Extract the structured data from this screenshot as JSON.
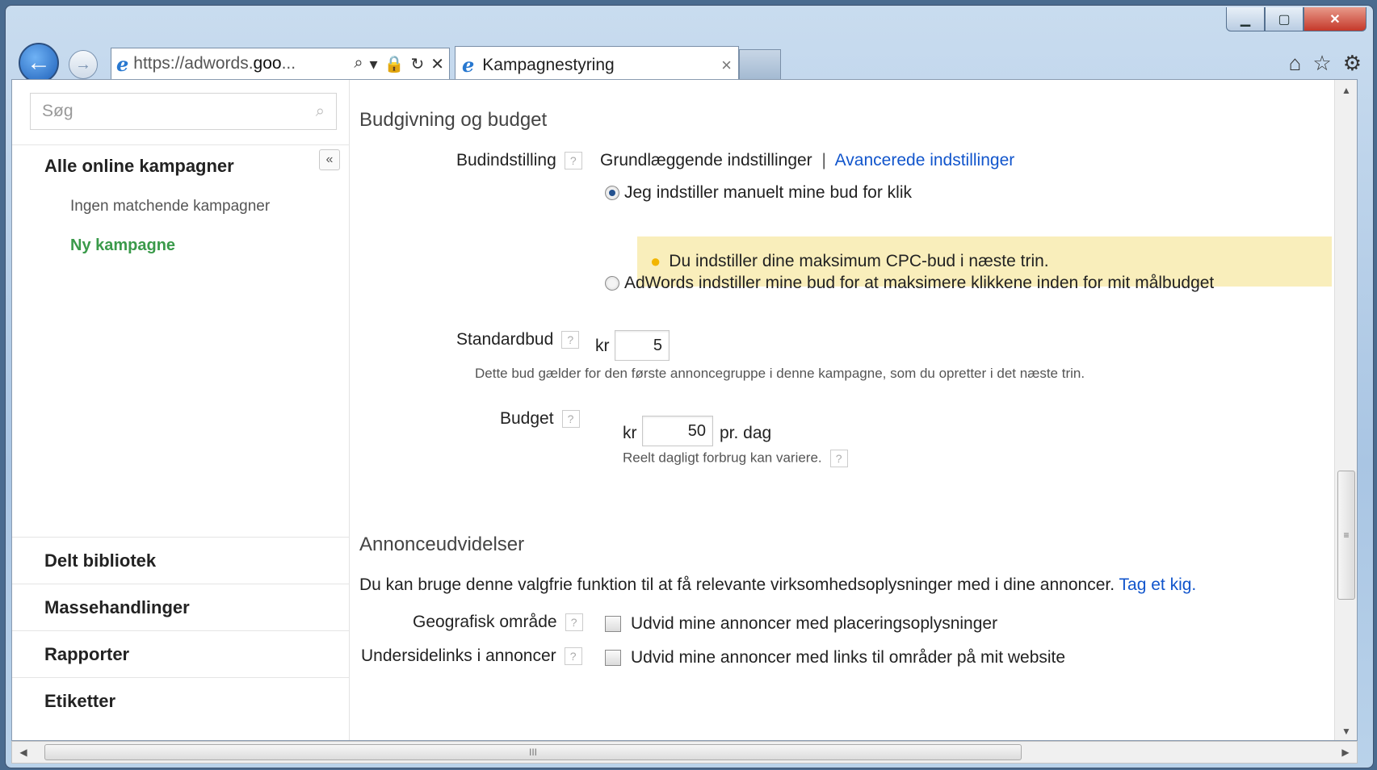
{
  "window": {
    "minimize_glyph": "▁",
    "maximize_glyph": "▢",
    "close_glyph": "✕"
  },
  "nav": {
    "back_glyph": "←",
    "forward_glyph": "→",
    "url_prefix": "https://adwords.",
    "url_bold": "goo",
    "url_suffix": "...",
    "search_glyph": "⌕",
    "dropdown_glyph": "▾",
    "lock_glyph": "🔒",
    "refresh_glyph": "↻",
    "stop_glyph": "✕"
  },
  "tab": {
    "title": "Kampagnestyring",
    "close_glyph": "×"
  },
  "toolbar": {
    "home_glyph": "⌂",
    "favorites_glyph": "☆",
    "tools_glyph": "⚙"
  },
  "sidebar": {
    "search_placeholder": "Søg",
    "collapse_glyph": "«",
    "all_campaigns": "Alle online kampagner",
    "no_matching": "Ingen matchende kampagner",
    "new_campaign": "Ny kampagne",
    "bottom_items": [
      "Delt bibliotek",
      "Massehandlinger",
      "Rapporter",
      "Etiketter"
    ]
  },
  "bidding": {
    "section_title": "Budgivning og budget",
    "bid_setting_label": "Budindstilling",
    "basic_settings": "Grundlæggende indstillinger",
    "separator": "|",
    "advanced_settings": "Avancerede indstillinger",
    "manual_option": "Jeg indstiller manuelt mine bud for klik",
    "note": "Du indstiller dine maksimum CPC-bud i næste trin.",
    "auto_option": "AdWords indstiller mine bud for at maksimere klikkene inden for mit målbudget",
    "default_bid_label": "Standardbud",
    "currency": "kr",
    "default_bid_value": "5",
    "default_bid_hint": "Dette bud gælder for den første annoncegruppe i denne kampagne, som du opretter i det næste trin.",
    "budget_label": "Budget",
    "budget_value": "50",
    "per_day": "pr. dag",
    "budget_hint": "Reelt dagligt forbrug kan variere."
  },
  "extensions": {
    "section_title": "Annonceudvidelser",
    "intro": "Du kan bruge denne valgfrie funktion til at få relevante virksomhedsoplysninger med i dine annoncer.",
    "intro_link": "Tag et kig.",
    "geo_label": "Geografisk område",
    "geo_option": "Udvid mine annoncer med placeringsoplysninger",
    "sitelinks_label": "Undersidelinks i annoncer",
    "sitelinks_option": "Udvid mine annoncer med links til områder på mit website"
  },
  "help_glyph": "?",
  "scrollbar": {
    "up_glyph": "▲",
    "down_glyph": "▼",
    "left_glyph": "◀",
    "right_glyph": "▶",
    "vgrip": "≡",
    "hgrip": "III"
  }
}
